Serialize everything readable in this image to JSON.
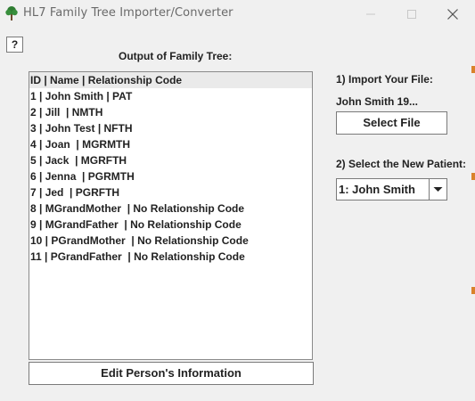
{
  "window": {
    "title": "HL7 Family Tree Importer/Converter",
    "minimize_icon": "minimize-icon",
    "maximize_icon": "maximize-icon",
    "close_icon": "close-icon",
    "close_glyph": "✕",
    "minimize_glyph": "—",
    "maximize_glyph": "☐"
  },
  "help_button": {
    "label": "?"
  },
  "output": {
    "label": "Output of Family Tree:",
    "rows": [
      "ID | Name | Relationship Code",
      "1 | John Smith | PAT",
      "2 | Jill  | NMTH",
      "3 | John Test | NFTH",
      "4 | Joan  | MGRMTH",
      "5 | Jack  | MGRFTH",
      "6 | Jenna  | PGRMTH",
      "7 | Jed  | PGRFTH",
      "8 | MGrandMother  | No Relationship Code",
      "9 | MGrandFather  | No Relationship Code",
      "10 | PGrandMother  | No Relationship Code",
      "11 | PGrandFather  | No Relationship Code"
    ],
    "selected_index": 0
  },
  "edit_button": {
    "label": "Edit Person's Information"
  },
  "import": {
    "label": "1) Import Your File:",
    "file_name": "John Smith 19...",
    "select_button_label": "Select File"
  },
  "patient": {
    "label": "2) Select the New Patient:",
    "selected_value": "1: John Smith",
    "arrow_icon": "chevron-down-icon"
  },
  "colors": {
    "background": "#f0f0f0",
    "app_icon": "#2e7d32",
    "edge_accent": "#d9822b"
  }
}
